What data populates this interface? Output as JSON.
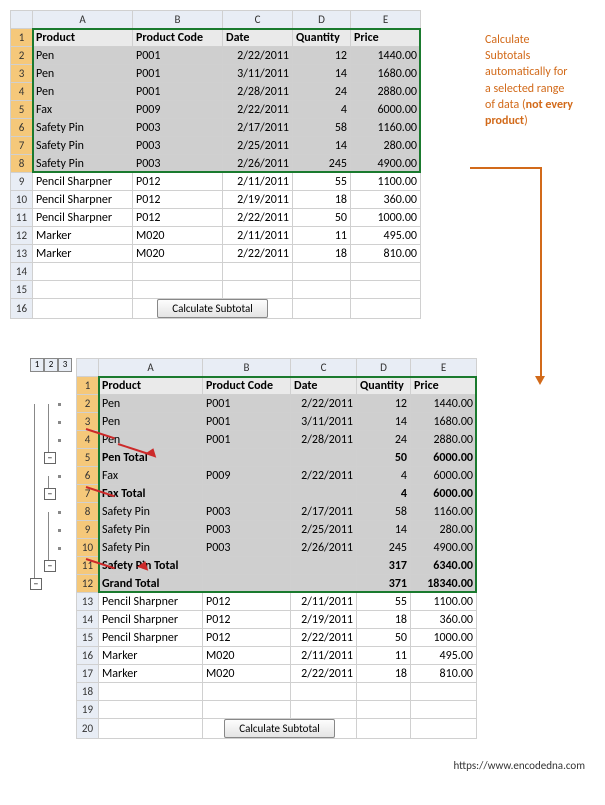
{
  "annotation": {
    "line1": "Calculate",
    "line2": "Subtotals",
    "line3": "automatically for",
    "line4": "a selected range",
    "line5": "of data (",
    "line6_strong": "not every product",
    "line7": ")"
  },
  "button": {
    "label": "Calculate Subtotal"
  },
  "footer_url": "https://www.encodedna.com",
  "columns": [
    "A",
    "B",
    "C",
    "D",
    "E"
  ],
  "outline_levels": [
    "1",
    "2",
    "3"
  ],
  "sheet1": {
    "headers": {
      "A": "Product",
      "B": "Product Code",
      "C": "Date",
      "D": "Quantity",
      "E": "Price"
    },
    "rows": [
      {
        "n": "2",
        "A": "Pen",
        "B": "P001",
        "C": "2/22/2011",
        "D": "12",
        "E": "1440.00",
        "sel": true
      },
      {
        "n": "3",
        "A": "Pen",
        "B": "P001",
        "C": "3/11/2011",
        "D": "14",
        "E": "1680.00",
        "sel": true
      },
      {
        "n": "4",
        "A": "Pen",
        "B": "P001",
        "C": "2/28/2011",
        "D": "24",
        "E": "2880.00",
        "sel": true
      },
      {
        "n": "5",
        "A": "Fax",
        "B": "P009",
        "C": "2/22/2011",
        "D": "4",
        "E": "6000.00",
        "sel": true
      },
      {
        "n": "6",
        "A": "Safety Pin",
        "B": "P003",
        "C": "2/17/2011",
        "D": "58",
        "E": "1160.00",
        "sel": true
      },
      {
        "n": "7",
        "A": "Safety Pin",
        "B": "P003",
        "C": "2/25/2011",
        "D": "14",
        "E": "280.00",
        "sel": true
      },
      {
        "n": "8",
        "A": "Safety Pin",
        "B": "P003",
        "C": "2/26/2011",
        "D": "245",
        "E": "4900.00",
        "sel": true
      },
      {
        "n": "9",
        "A": "Pencil Sharpner",
        "B": "P012",
        "C": "2/11/2011",
        "D": "55",
        "E": "1100.00"
      },
      {
        "n": "10",
        "A": "Pencil Sharpner",
        "B": "P012",
        "C": "2/19/2011",
        "D": "18",
        "E": "360.00"
      },
      {
        "n": "11",
        "A": "Pencil Sharpner",
        "B": "P012",
        "C": "2/22/2011",
        "D": "50",
        "E": "1000.00"
      },
      {
        "n": "12",
        "A": "Marker",
        "B": "M020",
        "C": "2/11/2011",
        "D": "11",
        "E": "495.00"
      },
      {
        "n": "13",
        "A": "Marker",
        "B": "M020",
        "C": "2/22/2011",
        "D": "18",
        "E": "810.00"
      },
      {
        "n": "14",
        "A": "",
        "B": "",
        "C": "",
        "D": "",
        "E": ""
      },
      {
        "n": "15",
        "A": "",
        "B": "",
        "C": "",
        "D": "",
        "E": ""
      }
    ],
    "button_row_n": "16"
  },
  "sheet2": {
    "headers": {
      "A": "Product",
      "B": "Product Code",
      "C": "Date",
      "D": "Quantity",
      "E": "Price"
    },
    "rows": [
      {
        "n": "2",
        "A": "Pen",
        "B": "P001",
        "C": "2/22/2011",
        "D": "12",
        "E": "1440.00",
        "sel": true
      },
      {
        "n": "3",
        "A": "Pen",
        "B": "P001",
        "C": "3/11/2011",
        "D": "14",
        "E": "1680.00",
        "sel": true
      },
      {
        "n": "4",
        "A": "Pen",
        "B": "P001",
        "C": "2/28/2011",
        "D": "24",
        "E": "2880.00",
        "sel": true
      },
      {
        "n": "5",
        "A": "Pen Total",
        "B": "",
        "C": "",
        "D": "50",
        "E": "6000.00",
        "sel": true,
        "bold": true
      },
      {
        "n": "6",
        "A": "Fax",
        "B": "P009",
        "C": "2/22/2011",
        "D": "4",
        "E": "6000.00",
        "sel": true
      },
      {
        "n": "7",
        "A": "Fax Total",
        "B": "",
        "C": "",
        "D": "4",
        "E": "6000.00",
        "sel": true,
        "bold": true
      },
      {
        "n": "8",
        "A": "Safety Pin",
        "B": "P003",
        "C": "2/17/2011",
        "D": "58",
        "E": "1160.00",
        "sel": true
      },
      {
        "n": "9",
        "A": "Safety Pin",
        "B": "P003",
        "C": "2/25/2011",
        "D": "14",
        "E": "280.00",
        "sel": true
      },
      {
        "n": "10",
        "A": "Safety Pin",
        "B": "P003",
        "C": "2/26/2011",
        "D": "245",
        "E": "4900.00",
        "sel": true
      },
      {
        "n": "11",
        "A": "Safety Pin Total",
        "B": "",
        "C": "",
        "D": "317",
        "E": "6340.00",
        "sel": true,
        "bold": true
      },
      {
        "n": "12",
        "A": "Grand Total",
        "B": "",
        "C": "",
        "D": "371",
        "E": "18340.00",
        "sel": true,
        "bold": true
      },
      {
        "n": "13",
        "A": "Pencil Sharpner",
        "B": "P012",
        "C": "2/11/2011",
        "D": "55",
        "E": "1100.00"
      },
      {
        "n": "14",
        "A": "Pencil Sharpner",
        "B": "P012",
        "C": "2/19/2011",
        "D": "18",
        "E": "360.00"
      },
      {
        "n": "15",
        "A": "Pencil Sharpner",
        "B": "P012",
        "C": "2/22/2011",
        "D": "50",
        "E": "1000.00"
      },
      {
        "n": "16",
        "A": "Marker",
        "B": "M020",
        "C": "2/11/2011",
        "D": "11",
        "E": "495.00"
      },
      {
        "n": "17",
        "A": "Marker",
        "B": "M020",
        "C": "2/22/2011",
        "D": "18",
        "E": "810.00"
      },
      {
        "n": "18",
        "A": "",
        "B": "",
        "C": "",
        "D": "",
        "E": ""
      },
      {
        "n": "19",
        "A": "",
        "B": "",
        "C": "",
        "D": "",
        "E": ""
      }
    ],
    "button_row_n": "20"
  },
  "colwidths": {
    "A": 100,
    "B": 90,
    "C": 70,
    "D": 58,
    "E": 70
  },
  "colwidths2": {
    "A": 104,
    "B": 88,
    "C": 66,
    "D": 54,
    "E": 66
  }
}
